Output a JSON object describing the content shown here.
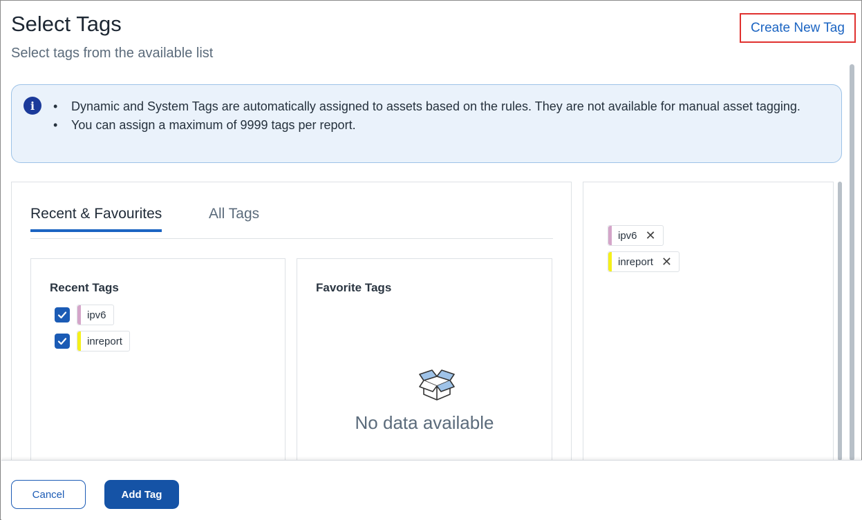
{
  "dialog": {
    "title": "Select Tags",
    "subtitle": "Select tags from the available list",
    "create_new_tag": "Create New Tag"
  },
  "info": {
    "icon": "info-icon",
    "items": [
      "Dynamic and System Tags are automatically assigned to assets based on the rules. They are not available for manual asset tagging.",
      "You can assign a maximum of 9999 tags per report."
    ]
  },
  "tabs": [
    {
      "label": "Recent & Favourites",
      "active": true
    },
    {
      "label": "All Tags",
      "active": false
    }
  ],
  "recent": {
    "title": "Recent Tags",
    "tags": [
      {
        "label": "ipv6",
        "checked": true,
        "color": "#d4a5c9"
      },
      {
        "label": "inreport",
        "checked": true,
        "color": "#f5f01a"
      }
    ]
  },
  "favorite": {
    "title": "Favorite Tags",
    "empty_icon": "empty-box-icon",
    "empty_text": "No data available"
  },
  "selected": {
    "tags": [
      {
        "label": "ipv6",
        "color": "#d4a5c9"
      },
      {
        "label": "inreport",
        "color": "#f5f01a"
      }
    ]
  },
  "footer": {
    "cancel": "Cancel",
    "add": "Add Tag"
  },
  "colors": {
    "accent": "#1b64c2",
    "highlight_border": "#e0302e",
    "info_bg": "#eaf2fb"
  }
}
